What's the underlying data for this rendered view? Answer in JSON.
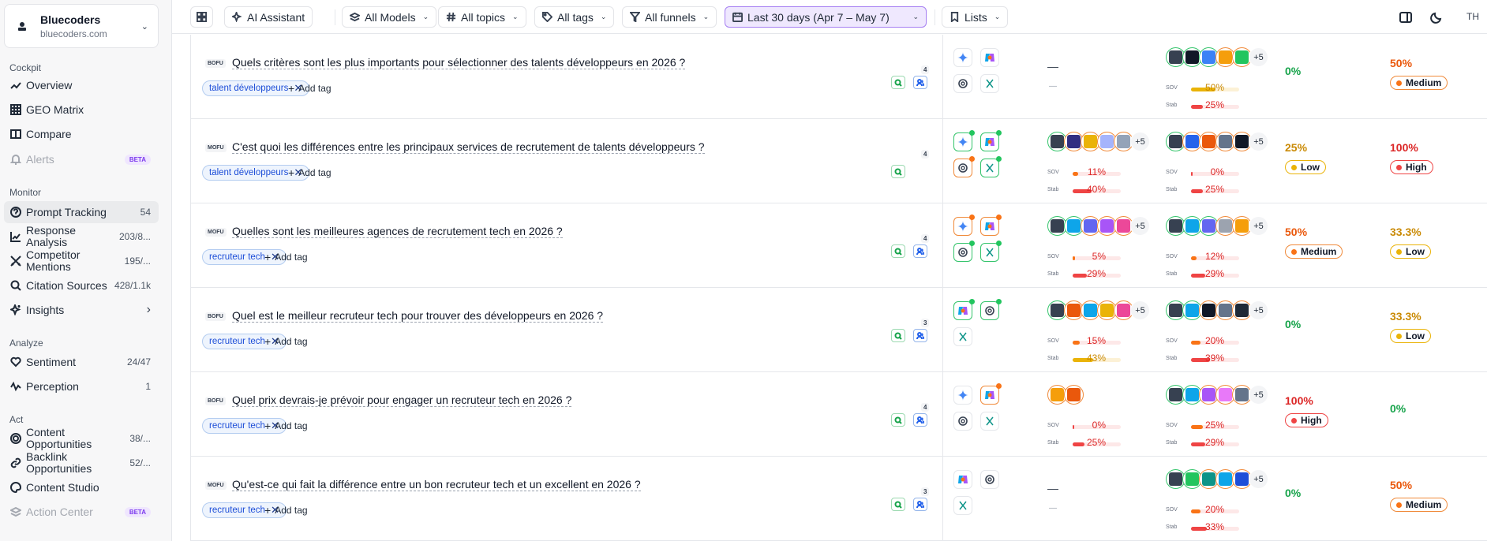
{
  "workspace": {
    "name": "Bluecoders",
    "domain": "bluecoders.com"
  },
  "sidebar": {
    "sections": {
      "cockpit": "Cockpit",
      "monitor": "Monitor",
      "analyze": "Analyze",
      "act": "Act"
    },
    "items": [
      {
        "label": "Overview",
        "count": ""
      },
      {
        "label": "GEO Matrix",
        "count": ""
      },
      {
        "label": "Compare",
        "count": ""
      },
      {
        "label": "Alerts",
        "badge": "BETA"
      },
      {
        "label": "Prompt Tracking",
        "count": "54"
      },
      {
        "label": "Response Analysis",
        "count": "203/8..."
      },
      {
        "label": "Competitor Mentions",
        "count": "195/..."
      },
      {
        "label": "Citation Sources",
        "count": "428/1.1k"
      },
      {
        "label": "Insights",
        "count": ""
      },
      {
        "label": "Sentiment",
        "count": "24/47"
      },
      {
        "label": "Perception",
        "count": "1"
      },
      {
        "label": "Content Opportunities",
        "count": "38/..."
      },
      {
        "label": "Backlink Opportunities",
        "count": "52/..."
      },
      {
        "label": "Content Studio",
        "count": ""
      },
      {
        "label": "Action Center",
        "badge": "BETA"
      }
    ]
  },
  "topbar": {
    "ai_assistant": "AI Assistant",
    "models": "All Models",
    "topics": "All topics",
    "tags": "All tags",
    "funnels": "All funnels",
    "date": "Last 30 days (Apr 7 – May 7)",
    "lists": "Lists",
    "user": "TH"
  },
  "labels": {
    "add_tag": "Add tag",
    "sov": "SOV",
    "stab": "Stab",
    "plus": "+5",
    "dash": "—"
  },
  "rows": [
    {
      "funnel": "BOFU",
      "question": "Quels critères sont les plus importants pour sélectionner des talents développeurs en 2026 ?",
      "tag": "talent développeurs",
      "count": "4",
      "brand": null,
      "comp": {
        "sov": "50%",
        "stab": "25%",
        "sov_fill": 0.5,
        "stab_fill": 0.25,
        "sov_color": "#eab308",
        "stab_color": "#ef4444"
      },
      "m1": {
        "value": "0%",
        "color": "#16a34a"
      },
      "m2": {
        "value": "50%",
        "color": "#ea580c",
        "level": "Medium",
        "level_color": "#f97316",
        "border": "#f08a3a"
      }
    },
    {
      "funnel": "MOFU",
      "question": "C'est quoi les différences entre les principaux services de recrutement de talents développeurs ?",
      "tag": "talent développeurs",
      "count": "4",
      "brand": {
        "sov": "11%",
        "stab": "40%",
        "sov_fill": 0.11,
        "stab_fill": 0.4,
        "sov_color": "#f97316",
        "stab_color": "#ef4444"
      },
      "comp": {
        "sov": "0%",
        "stab": "25%",
        "sov_fill": 0.02,
        "stab_fill": 0.25,
        "sov_color": "#ef4444",
        "stab_color": "#ef4444"
      },
      "m1": {
        "value": "25%",
        "color": "#ca8a04",
        "level": "Low",
        "level_color": "#eab308",
        "border": "#eab308"
      },
      "m2": {
        "value": "100%",
        "color": "#dc2626",
        "level": "High",
        "level_color": "#ef4444",
        "border": "#ef4444"
      }
    },
    {
      "funnel": "MOFU",
      "question": "Quelles sont les meilleures agences de recrutement tech en 2026 ?",
      "tag": "recruteur tech",
      "count": "4",
      "brand": {
        "sov": "5%",
        "stab": "29%",
        "sov_fill": 0.05,
        "stab_fill": 0.29,
        "sov_color": "#f97316",
        "stab_color": "#ef4444"
      },
      "comp": {
        "sov": "12%",
        "stab": "29%",
        "sov_fill": 0.12,
        "stab_fill": 0.29,
        "sov_color": "#f97316",
        "stab_color": "#ef4444"
      },
      "m1": {
        "value": "50%",
        "color": "#ea580c",
        "level": "Medium",
        "level_color": "#f97316",
        "border": "#f08a3a"
      },
      "m2": {
        "value": "33.3%",
        "color": "#ca8a04",
        "level": "Low",
        "level_color": "#eab308",
        "border": "#eab308"
      }
    },
    {
      "funnel": "BOFU",
      "question": "Quel est le meilleur recruteur tech pour trouver des développeurs en 2026 ?",
      "tag": "recruteur tech",
      "count": "3",
      "brand": {
        "sov": "15%",
        "stab": "43%",
        "sov_fill": 0.15,
        "stab_fill": 0.43,
        "sov_color": "#f97316",
        "stab_color": "#eab308"
      },
      "comp": {
        "sov": "20%",
        "stab": "39%",
        "sov_fill": 0.2,
        "stab_fill": 0.39,
        "sov_color": "#f97316",
        "stab_color": "#ef4444"
      },
      "m1": {
        "value": "0%",
        "color": "#16a34a"
      },
      "m2": {
        "value": "33.3%",
        "color": "#ca8a04",
        "level": "Low",
        "level_color": "#eab308",
        "border": "#eab308"
      }
    },
    {
      "funnel": "BOFU",
      "question": "Quel prix devrais-je prévoir pour engager un recruteur tech en 2026 ?",
      "tag": "recruteur tech",
      "count": "4",
      "brand": {
        "sov": "0%",
        "stab": "25%",
        "sov_fill": 0.02,
        "stab_fill": 0.25,
        "sov_color": "#ef4444",
        "stab_color": "#ef4444"
      },
      "comp": {
        "sov": "25%",
        "stab": "29%",
        "sov_fill": 0.25,
        "stab_fill": 0.29,
        "sov_color": "#f97316",
        "stab_color": "#ef4444"
      },
      "m1": {
        "value": "100%",
        "color": "#dc2626",
        "level": "High",
        "level_color": "#ef4444",
        "border": "#ef4444"
      },
      "m2": {
        "value": "0%",
        "color": "#16a34a"
      }
    },
    {
      "funnel": "MOFU",
      "question": "Qu'est-ce qui fait la différence entre un bon recruteur tech et un excellent en 2026 ?",
      "tag": "recruteur tech",
      "count": "3",
      "brand": null,
      "comp": {
        "sov": "20%",
        "stab": "33%",
        "sov_fill": 0.2,
        "stab_fill": 0.33,
        "sov_color": "#f97316",
        "stab_color": "#ef4444"
      },
      "m1": {
        "value": "0%",
        "color": "#16a34a"
      },
      "m2": {
        "value": "50%",
        "color": "#ea580c",
        "level": "Medium",
        "level_color": "#f97316",
        "border": "#f08a3a"
      }
    }
  ]
}
